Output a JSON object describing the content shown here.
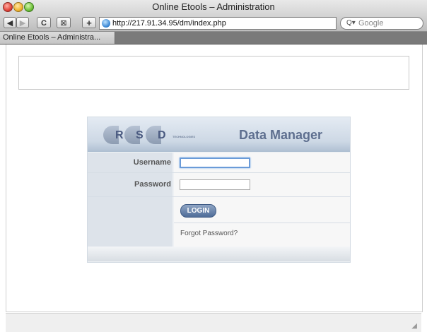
{
  "window": {
    "title": "Online Etools – Administration"
  },
  "toolbar": {
    "back_label": "◀",
    "forward_label": "▶",
    "reload_label": "C",
    "bookmark_label": "⊠",
    "add_label": "+",
    "url": "http://217.91.34.95/dm/index.php",
    "search_placeholder": "Google",
    "search_icon": "Q▾"
  },
  "tabs": [
    {
      "label": "Online Etools – Administra..."
    }
  ],
  "login": {
    "brand_letters": [
      "R",
      "S",
      "D"
    ],
    "brand_tagline": "TECHNOLOGIES",
    "title": "Data Manager",
    "username_label": "Username",
    "password_label": "Password",
    "username_value": "",
    "password_value": "",
    "login_button": "LOGIN",
    "forgot_link": "Forgot Password?"
  }
}
